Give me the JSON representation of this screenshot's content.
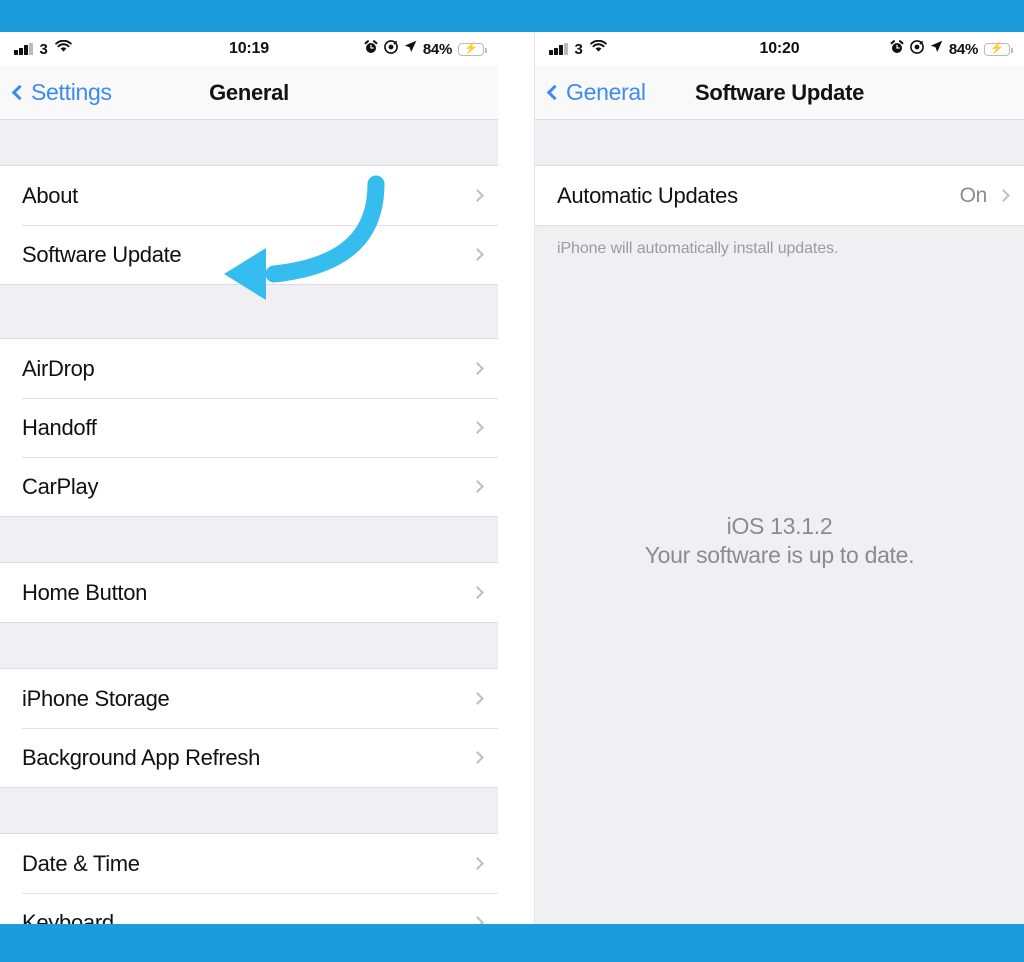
{
  "theme": {
    "frame_blue": "#1d9cdc",
    "accent_blue": "#3d8bf2",
    "annotation_blue": "#35bdf0",
    "battery_green": "#3ad14f",
    "list_bg": "#ffffff",
    "group_bg": "#efeff4",
    "secondary_text": "#8b8b90"
  },
  "left_phone": {
    "status_bar": {
      "carrier": "3",
      "signal_icon": "signal-bars-icon",
      "wifi_icon": "wifi-icon",
      "time": "10:19",
      "alarm_icon": "alarm-clock-icon",
      "orientation_lock_icon": "orientation-lock-icon",
      "location_icon": "location-arrow-icon",
      "battery_percent": "84%",
      "battery_icon": "battery-charging-icon"
    },
    "nav": {
      "back_label": "Settings",
      "back_icon": "chevron-left-icon",
      "title": "General"
    },
    "sections": [
      {
        "rows": [
          {
            "label": "About",
            "value": "",
            "chevron": "chevron-right-icon"
          },
          {
            "label": "Software Update",
            "value": "",
            "chevron": "chevron-right-icon"
          }
        ]
      },
      {
        "rows": [
          {
            "label": "AirDrop",
            "value": "",
            "chevron": "chevron-right-icon"
          },
          {
            "label": "Handoff",
            "value": "",
            "chevron": "chevron-right-icon"
          },
          {
            "label": "CarPlay",
            "value": "",
            "chevron": "chevron-right-icon"
          }
        ]
      },
      {
        "rows": [
          {
            "label": "Home Button",
            "value": "",
            "chevron": "chevron-right-icon"
          }
        ]
      },
      {
        "rows": [
          {
            "label": "iPhone Storage",
            "value": "",
            "chevron": "chevron-right-icon"
          },
          {
            "label": "Background App Refresh",
            "value": "",
            "chevron": "chevron-right-icon"
          }
        ]
      },
      {
        "rows": [
          {
            "label": "Date & Time",
            "value": "",
            "chevron": "chevron-right-icon"
          },
          {
            "label": "Keyboard",
            "value": "",
            "chevron": "chevron-right-icon"
          }
        ]
      }
    ],
    "annotation": {
      "name": "curved-arrow-annotation",
      "points_to": "Software Update",
      "color": "#35bdf0"
    }
  },
  "right_phone": {
    "status_bar": {
      "carrier": "3",
      "signal_icon": "signal-bars-icon",
      "wifi_icon": "wifi-icon",
      "time": "10:20",
      "alarm_icon": "alarm-clock-icon",
      "orientation_lock_icon": "orientation-lock-icon",
      "location_icon": "location-arrow-icon",
      "battery_percent": "84%",
      "battery_icon": "battery-charging-icon"
    },
    "nav": {
      "back_label": "General",
      "back_icon": "chevron-left-icon",
      "title": "Software Update"
    },
    "row": {
      "label": "Automatic Updates",
      "value": "On",
      "chevron": "chevron-right-icon"
    },
    "footnote": "iPhone will automatically install updates.",
    "status": {
      "version": "iOS 13.1.2",
      "message": "Your software is up to date."
    }
  }
}
